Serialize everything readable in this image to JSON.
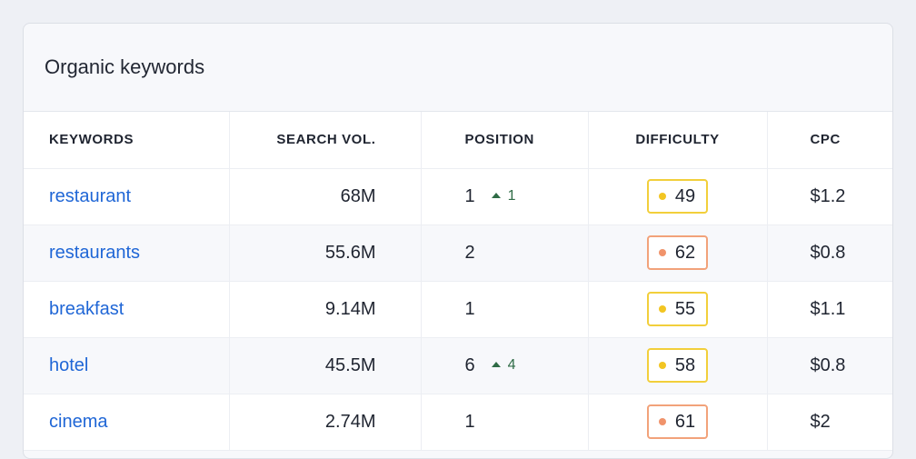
{
  "card": {
    "title": "Organic keywords"
  },
  "columns": [
    "KEYWORDS",
    "SEARCH VOL.",
    "POSITION",
    "DIFFICULTY",
    "CPC"
  ],
  "rows": [
    {
      "keyword": "restaurant",
      "volume": "68M",
      "position": "1",
      "change": "1",
      "difficulty": "49",
      "level": "medium",
      "cpc": "$1.2"
    },
    {
      "keyword": "restaurants",
      "volume": "55.6M",
      "position": "2",
      "change": null,
      "difficulty": "62",
      "level": "hard",
      "cpc": "$0.8"
    },
    {
      "keyword": "breakfast",
      "volume": "9.14M",
      "position": "1",
      "change": null,
      "difficulty": "55",
      "level": "medium",
      "cpc": "$1.1"
    },
    {
      "keyword": "hotel",
      "volume": "45.5M",
      "position": "6",
      "change": "4",
      "difficulty": "58",
      "level": "medium",
      "cpc": "$0.8"
    },
    {
      "keyword": "cinema",
      "volume": "2.74M",
      "position": "1",
      "change": null,
      "difficulty": "61",
      "level": "hard",
      "cpc": "$2"
    }
  ],
  "difficulty_colors": {
    "medium": {
      "border": "#f2cf3b",
      "dot": "#f2c522"
    },
    "hard": {
      "border": "#f2a27a",
      "dot": "#f0936b"
    }
  },
  "trend_icon": "arrow-up-icon"
}
